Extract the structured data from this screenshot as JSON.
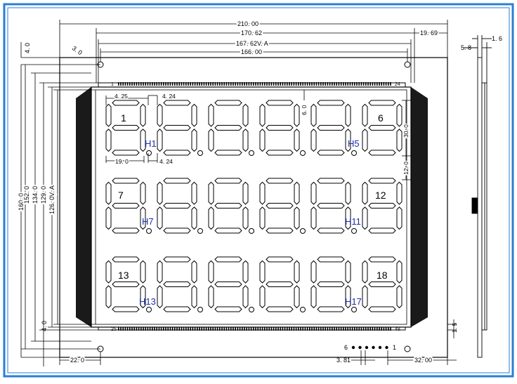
{
  "colors": {
    "frame": "#2a7fd4",
    "line": "#000000",
    "segment_fill": "#ffffff",
    "blue_label": "#1c2fa8",
    "glass_dark": "#1a1a1a"
  },
  "dimensions": {
    "width_total": "210. 00",
    "width_1": "170. 62",
    "width_va": "167. 62V. A",
    "width_2": "166. 00",
    "right_margin": "19. 69",
    "hole_dia": "3. 0",
    "top_offset": "4. 0",
    "h160": "160. 0",
    "h152": "152. 0",
    "h134": "134. 0",
    "h129": "129. 0",
    "h126va": "126. 0V. A",
    "d425": "4. 25",
    "d424a": "4. 24",
    "d424b": "4. 24",
    "d190": "19. 0",
    "d60": "6. 0",
    "d300": "30. 0",
    "d120": "12. 0",
    "bottom_offset": "4. 0",
    "b15": "1. 5",
    "b220": "22. 0",
    "b381": "3. 81",
    "b3200": "32. 00",
    "side_16": "1. 6",
    "side_58": "5. 8"
  },
  "digit_labels": {
    "d1": "1",
    "d6": "6",
    "d7": "7",
    "d12": "12",
    "d13": "13",
    "d18": "18"
  },
  "h_labels": {
    "h1": "H1",
    "h5": "H5",
    "h7": "H7",
    "h11": "H11",
    "h13": "H13",
    "h17": "H17"
  },
  "pin_labels": {
    "top_left": "1",
    "top_right": "24",
    "bottom_left": "25",
    "bottom_right": "48",
    "conn_left": "6",
    "conn_right": "1"
  }
}
